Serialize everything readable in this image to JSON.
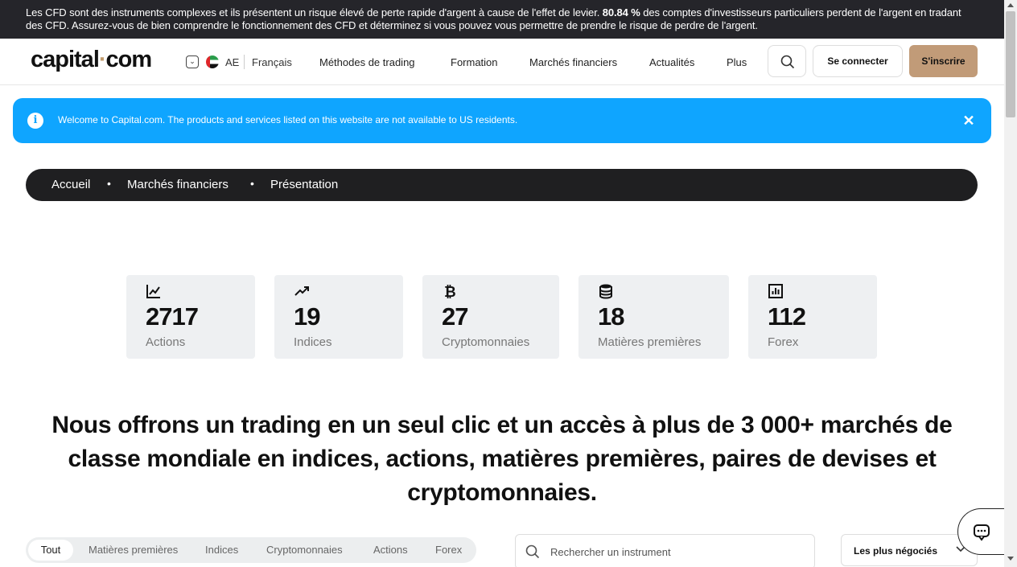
{
  "risk_banner": {
    "text_before": "Les CFD sont des instruments complexes et ils présentent un risque élevé de perte rapide d'argent à cause de l'effet de levier. ",
    "percent": "80.84 %",
    "text_after": " des comptes d'investisseurs particuliers perdent de l'argent en tradant des CFD. Assurez-vous de bien comprendre le fonctionnement des CFD et déterminez si vous pouvez vous permettre de prendre le risque de perdre de l'argent."
  },
  "header": {
    "logo_left": "capital",
    "logo_dot": "·",
    "logo_right": "com",
    "lang_toggle": "⌄",
    "region": "AE",
    "language": "Français",
    "nav": [
      "Méthodes de trading",
      "Formation",
      "Marchés financiers",
      "Actualités",
      "Plus"
    ],
    "login": "Se connecter",
    "signup": "S'inscrire"
  },
  "info_bar": {
    "icon": "i",
    "text": "Welcome to Capital.com. The products and services listed on this website are not available to US residents.",
    "close": "✕"
  },
  "breadcrumb": {
    "items": [
      "Accueil",
      "Marchés financiers",
      "Présentation"
    ],
    "separator": "•"
  },
  "stats": [
    {
      "icon": "chart-line-icon",
      "value": "2717",
      "label": "Actions"
    },
    {
      "icon": "trending-up-icon",
      "value": "19",
      "label": "Indices"
    },
    {
      "icon": "bitcoin-icon",
      "value": "27",
      "label": "Cryptomonnaies"
    },
    {
      "icon": "database-icon",
      "value": "18",
      "label": "Matières premières"
    },
    {
      "icon": "bar-chart-icon",
      "value": "112",
      "label": "Forex"
    }
  ],
  "headline": {
    "line1": "Nous offrons un trading en un seul clic et un accès à plus de 3 000+ marchés de",
    "line2": "classe mondiale en indices, actions, matières premières, paires de devises et",
    "line3": "cryptomonnaies."
  },
  "filters": {
    "active": "Tout",
    "tabs": [
      "Matières premières",
      "Indices",
      "Cryptomonnaies",
      "Actions",
      "Forex"
    ]
  },
  "instrument_search": {
    "placeholder": "Rechercher un instrument"
  },
  "sort": {
    "selected": "Les plus négociés"
  },
  "colors": {
    "brand_accent": "#c19b78",
    "info_blue": "#0fa5ff",
    "dark": "#1f1f21"
  }
}
